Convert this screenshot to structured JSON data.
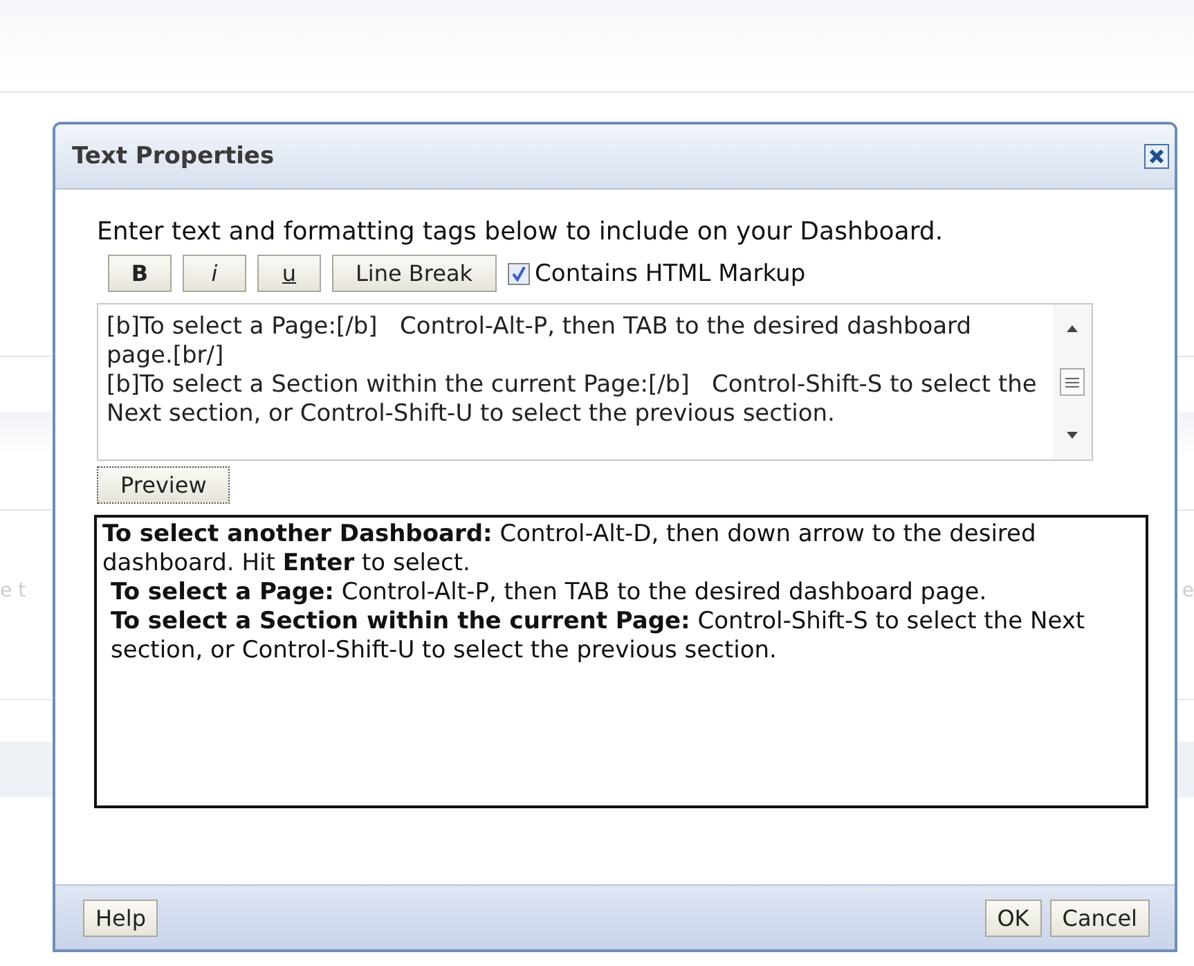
{
  "background_text": [
    "e t",
    "e"
  ],
  "dialog": {
    "title": "Text Properties",
    "instruction": "Enter text and formatting tags below to include on your Dashboard.",
    "format_buttons": [
      {
        "label": "B",
        "kind": "bold"
      },
      {
        "label": "i",
        "kind": "italic"
      },
      {
        "label": "u",
        "kind": "underline"
      },
      {
        "label": "Line Break",
        "kind": "plain"
      }
    ],
    "html_markup": {
      "label": "Contains HTML Markup",
      "checked": true
    },
    "editor_lines": [
      "[b]To select a Page:[/b]   Control-Alt-P, then TAB to the desired dashboard page.[br/]",
      "[b]To select a Section within the current Page:[/b]   Control-Shift-S to select the Next section, or Control-Shift-U to select the previous section."
    ],
    "preview_button": "Preview",
    "preview_paragraphs": [
      "**To select another Dashboard:** Control-Alt-D, then down arrow to the desired dashboard. Hit **Enter** to select.",
      "**To select a Page:** Control-Alt-P, then TAB to the desired dashboard page.",
      "**To select a Section within the current Page:** Control-Shift-S to select the Next section, or Control-Shift-U to select the previous section."
    ],
    "footer_left": [
      "Help"
    ],
    "footer_right": [
      "OK",
      "Cancel"
    ]
  }
}
